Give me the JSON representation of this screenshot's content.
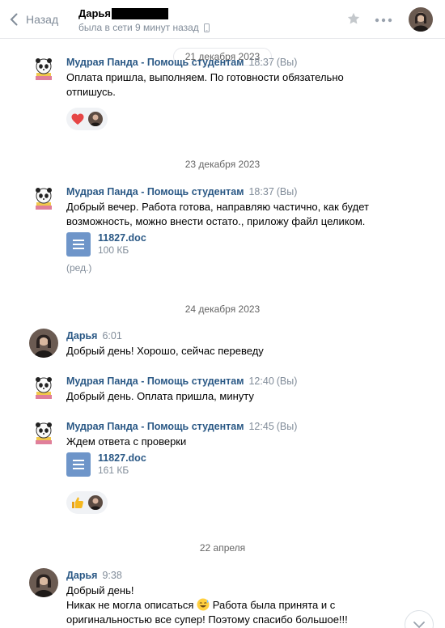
{
  "header": {
    "back_label": "Назад",
    "peer_name": "Дарья",
    "peer_status": "была в сети 9 минут назад"
  },
  "colors": {
    "link": "#2a5885",
    "muted": "#818c99",
    "doc_icon": "#6e95c9"
  },
  "dates": {
    "d1": "21 декабря 2023",
    "d2": "23 декабря 2023",
    "d3": "24 декабря 2023",
    "d4": "22 апреля"
  },
  "messages": [
    {
      "author": "Мудрая Панда - Помощь студентам",
      "time": "18:37",
      "you": "(Вы)",
      "text": "Оплата пришла, выполняем. По готовности обязательно отпишусь.",
      "reaction": "heart"
    },
    {
      "author": "Мудрая Панда - Помощь студентам",
      "time": "18:37",
      "you": "(Вы)",
      "text": "Добрый вечер. Работа готова, направляю частично, как будет возможность, можно внести остато., приложу файл целиком.",
      "doc": {
        "name": "11827.doc",
        "size": "100 КБ"
      },
      "edited": "(ред.)"
    },
    {
      "author": "Дарья",
      "time": "6:01",
      "text": "Добрый день! Хорошо, сейчас переведу"
    },
    {
      "author": "Мудрая Панда - Помощь студентам",
      "time": "12:40",
      "you": "(Вы)",
      "text": "Добрый день. Оплата пришла, минуту"
    },
    {
      "author": "Мудрая Панда - Помощь студентам",
      "time": "12:45",
      "you": "(Вы)",
      "text": "Ждем ответа с проверки",
      "doc": {
        "name": "11827.doc",
        "size": "161 КБ"
      },
      "reaction": "thumbs-up"
    },
    {
      "author": "Дарья",
      "time": "9:38",
      "line1": "Добрый день!",
      "line2a": "Никак не могла описаться",
      "line2b": "Работа была принята и с оригинальностью все супер! Поэтому спасибо большое!!!"
    }
  ]
}
